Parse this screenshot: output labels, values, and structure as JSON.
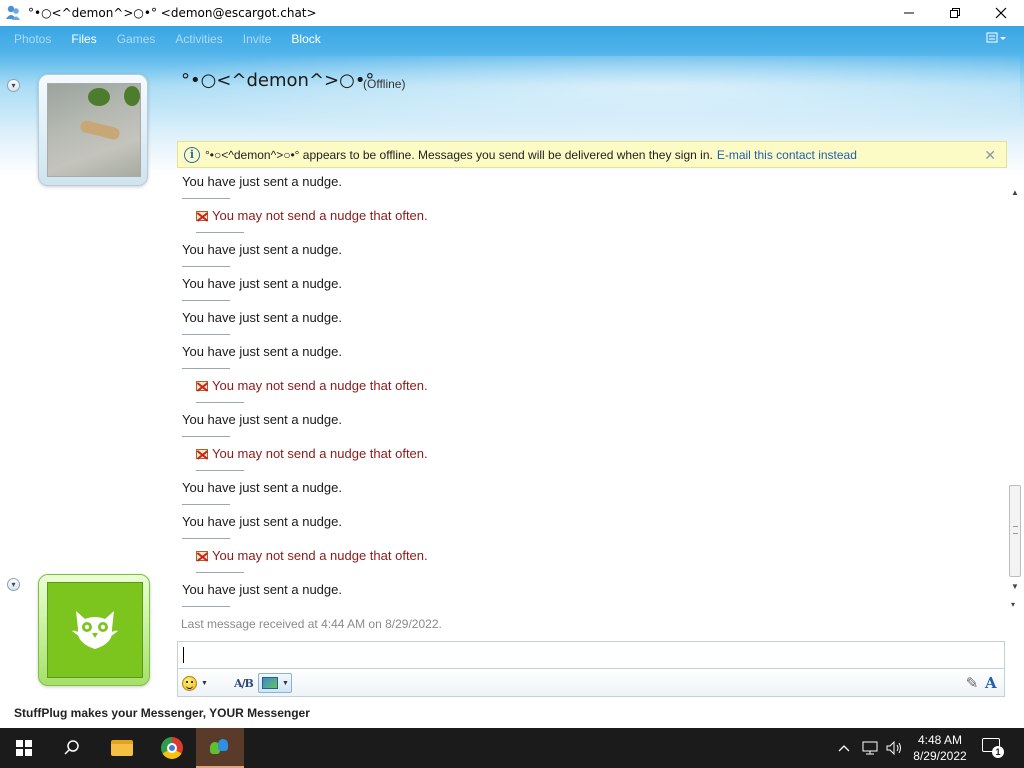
{
  "window": {
    "title": "°•○<^demon^>○•° <demon@escargot.chat>",
    "icon": "msn-buddies-icon"
  },
  "menu": {
    "items": [
      {
        "label": "Photos",
        "enabled": false
      },
      {
        "label": "Files",
        "enabled": true
      },
      {
        "label": "Games",
        "enabled": false
      },
      {
        "label": "Activities",
        "enabled": false
      },
      {
        "label": "Invite",
        "enabled": false
      },
      {
        "label": "Block",
        "enabled": true
      }
    ]
  },
  "contact": {
    "name": "°•○<^demon^>○•°",
    "status": "(Offline)"
  },
  "infobar": {
    "message": "°•○<^demon^>○•° appears to be offline. Messages you send will be delivered when they sign in.",
    "link": "E-mail this contact instead"
  },
  "conversation": {
    "messages": [
      {
        "type": "info",
        "text": "You have just sent a nudge."
      },
      {
        "type": "error",
        "text": "You may not send a nudge that often."
      },
      {
        "type": "info",
        "text": "You have just sent a nudge."
      },
      {
        "type": "info",
        "text": "You have just sent a nudge."
      },
      {
        "type": "info",
        "text": "You have just sent a nudge."
      },
      {
        "type": "info",
        "text": "You have just sent a nudge."
      },
      {
        "type": "error",
        "text": "You may not send a nudge that often."
      },
      {
        "type": "info",
        "text": "You have just sent a nudge."
      },
      {
        "type": "error",
        "text": "You may not send a nudge that often."
      },
      {
        "type": "info",
        "text": "You have just sent a nudge."
      },
      {
        "type": "info",
        "text": "You have just sent a nudge."
      },
      {
        "type": "error",
        "text": "You may not send a nudge that often."
      },
      {
        "type": "info",
        "text": "You have just sent a nudge."
      }
    ],
    "last_received": "Last message received at 4:44 AM on 8/29/2022."
  },
  "compose": {
    "value": ""
  },
  "footer": {
    "banner": "StuffPlug makes your Messenger, YOUR Messenger"
  },
  "taskbar": {
    "time": "4:48 AM",
    "date": "8/29/2022",
    "notifications": "1"
  }
}
